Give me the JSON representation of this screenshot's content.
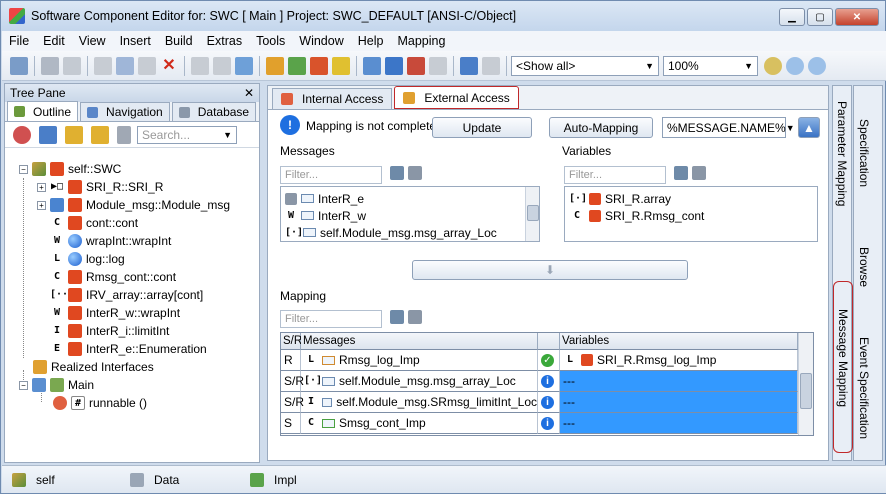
{
  "window": {
    "title": "Software Component Editor for: SWC [ Main ] Project: SWC_DEFAULT [ANSI-C/Object]"
  },
  "menu": [
    "File",
    "Edit",
    "View",
    "Insert",
    "Build",
    "Extras",
    "Tools",
    "Window",
    "Help",
    "Mapping"
  ],
  "toolbar": {
    "filter_value": "<Show all>",
    "zoom_value": "100%"
  },
  "tree_pane": {
    "title": "Tree Pane",
    "tabs": [
      "Outline",
      "Navigation",
      "Database"
    ],
    "search_placeholder": "Search...",
    "nodes": {
      "root": "self::SWC",
      "n1": "SRI_R::SRI_R",
      "n2": "Module_msg::Module_msg",
      "n3": "cont::cont",
      "n4": "wrapInt::wrapInt",
      "n5": "log::log",
      "n6": "Rmsg_cont::cont",
      "n7": "IRV_array::array[cont]",
      "n8": "InterR_w::wrapInt",
      "n9": "InterR_i::limitInt",
      "n10": "InterR_e::Enumeration",
      "realized": "Realized Interfaces",
      "main": "Main",
      "runnable": "runnable ()"
    }
  },
  "main": {
    "tabs": {
      "internal": "Internal Access",
      "external": "External Access"
    },
    "status_text": "Mapping is not complete!",
    "update_label": "Update",
    "automap_label": "Auto-Mapping",
    "pattern_value": "%MESSAGE.NAME%",
    "messages_label": "Messages",
    "variables_label": "Variables",
    "mapping_label": "Mapping",
    "filter_placeholder": "Filter...",
    "messages": [
      "InterR_e",
      "InterR_w",
      "self.Module_msg.msg_array_Loc"
    ],
    "variables": [
      "SRI_R.array",
      "SRI_R.Rmsg_cont"
    ],
    "grid": {
      "headers": [
        "S/R",
        "Messages",
        "",
        "Variables"
      ],
      "rows": [
        {
          "sr": "R",
          "message": "Rmsg_log_Imp",
          "variable": "SRI_R.Rmsg_log_Imp"
        },
        {
          "sr": "S/R",
          "message": "self.Module_msg.msg_array_Loc",
          "variable": "---"
        },
        {
          "sr": "S/R",
          "message": "self.Module_msg.SRmsg_limitInt_Loc",
          "variable": "---"
        },
        {
          "sr": "S",
          "message": "Smsg_cont_Imp",
          "variable": "---"
        }
      ]
    }
  },
  "side_tabs": {
    "inner_top": "Parameter Mapping",
    "inner_bottom": "Message Mapping",
    "outer_top": "Specification",
    "outer_mid": "Browse",
    "outer_bottom": "Event Specification"
  },
  "statusbar": {
    "self": "self",
    "data": "Data",
    "impl": "Impl"
  }
}
